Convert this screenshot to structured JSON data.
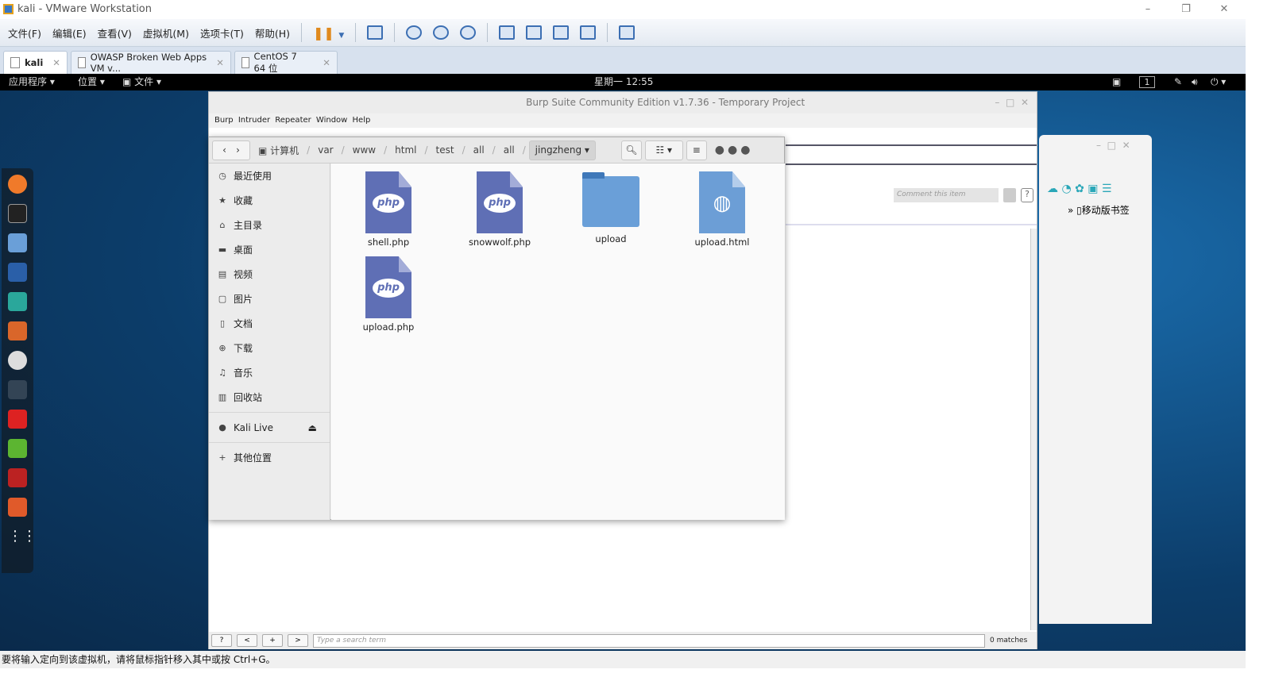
{
  "window": {
    "title": "kali - VMware Workstation"
  },
  "menu": [
    "文件(F)",
    "编辑(E)",
    "查看(V)",
    "虚拟机(M)",
    "选项卡(T)",
    "帮助(H)"
  ],
  "tabs": [
    {
      "label": "kali",
      "active": true
    },
    {
      "label": "OWASP Broken Web Apps VM v..."
    },
    {
      "label": "CentOS 7 64 位"
    }
  ],
  "kali_bar": {
    "apps": "应用程序 ▾",
    "places": "位置 ▾",
    "files": "文件 ▾",
    "clock": "星期一 12:55",
    "workspace": "1"
  },
  "burp": {
    "title": "Burp Suite Community Edition v1.7.36 - Temporary Project",
    "menu": "Burp Intruder Repeater Window Help",
    "comment_placeholder": "Comment this item",
    "search_placeholder": "Type a search term",
    "matches": "0 matches",
    "buttons": [
      "?",
      "<",
      "+",
      ">"
    ]
  },
  "files": {
    "path": [
      "计算机",
      "var",
      "www",
      "html",
      "test",
      "all",
      "all"
    ],
    "current": "jingzheng",
    "sidebar": [
      {
        "icon": "clock",
        "label": "最近使用"
      },
      {
        "icon": "star",
        "label": "收藏"
      },
      {
        "icon": "home",
        "label": "主目录"
      },
      {
        "icon": "desktop",
        "label": "桌面"
      },
      {
        "icon": "video",
        "label": "视频"
      },
      {
        "icon": "image",
        "label": "图片"
      },
      {
        "icon": "document",
        "label": "文档"
      },
      {
        "icon": "download",
        "label": "下载"
      },
      {
        "icon": "music",
        "label": "音乐"
      },
      {
        "icon": "trash",
        "label": "回收站"
      }
    ],
    "device": "Kali Live",
    "other": "其他位置",
    "items": [
      {
        "name": "shell.php",
        "type": "php"
      },
      {
        "name": "snowwolf.php",
        "type": "php"
      },
      {
        "name": "upload",
        "type": "folder"
      },
      {
        "name": "upload.html",
        "type": "html"
      },
      {
        "name": "upload.php",
        "type": "php"
      }
    ],
    "php_label": "php"
  },
  "right_window": {
    "bookmark": "移动版书签"
  },
  "status": "要将输入定向到该虚拟机，请将鼠标指针移入其中或按 Ctrl+G。"
}
